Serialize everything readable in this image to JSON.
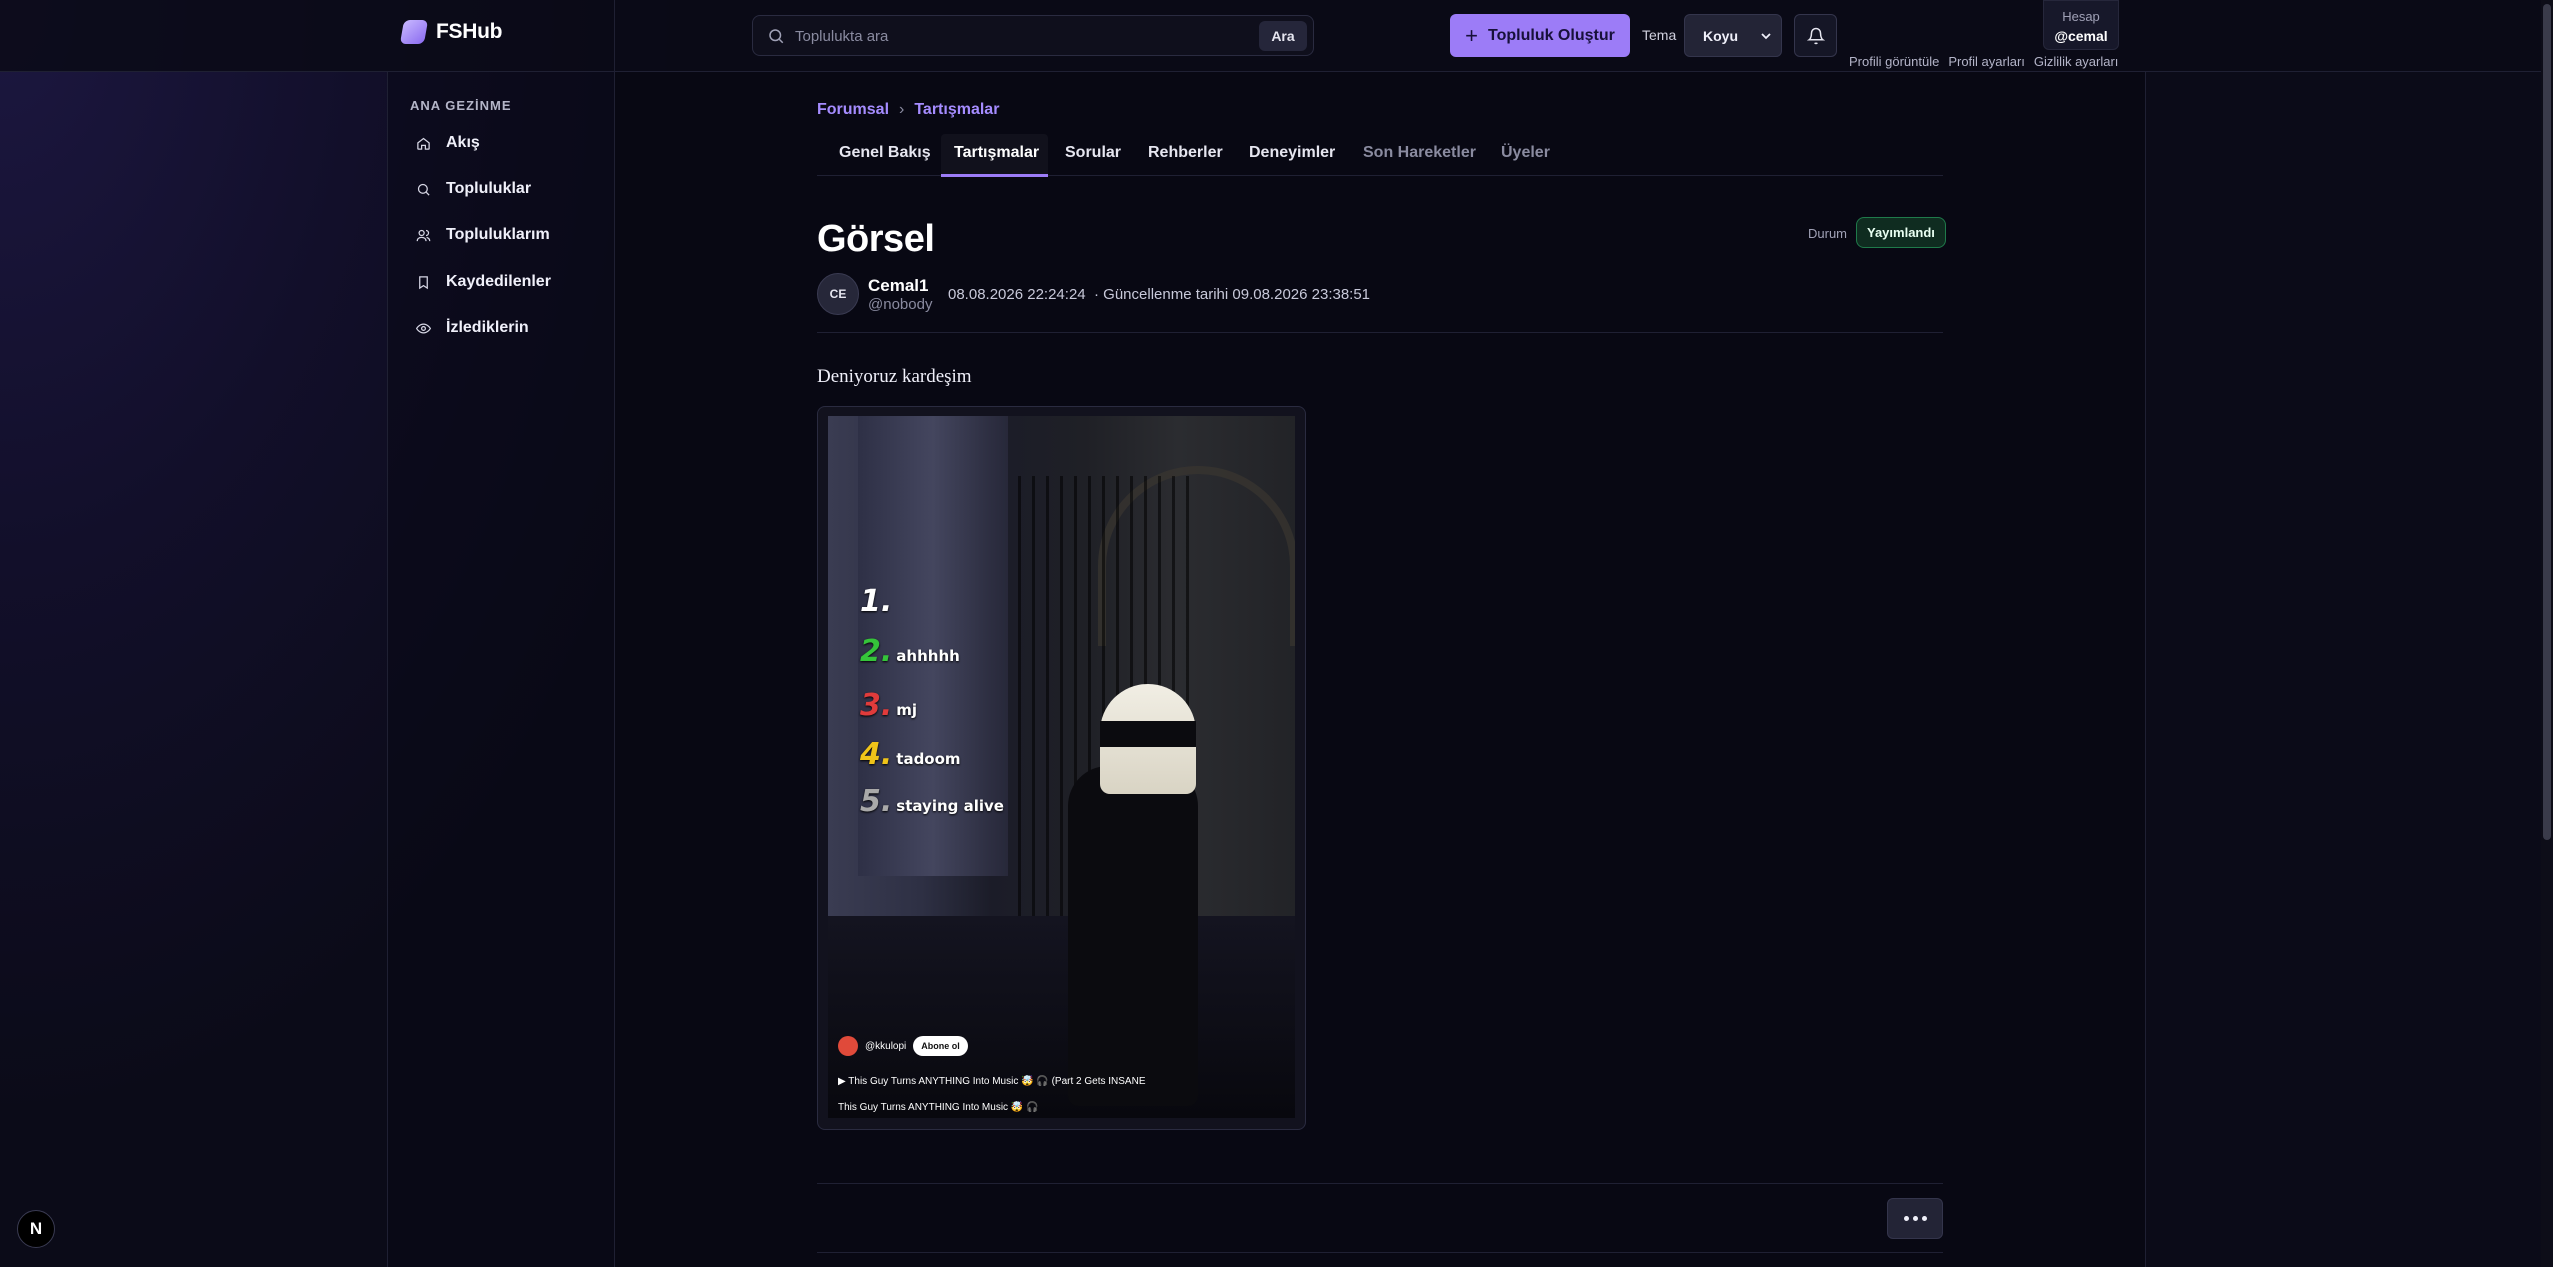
{
  "brand": {
    "name": "FSHub"
  },
  "search": {
    "placeholder": "Toplulukta ara",
    "button": "Ara"
  },
  "header": {
    "create_button": "Topluluk Oluştur",
    "theme_label": "Tema",
    "theme_value": "Koyu",
    "account_label": "Hesap",
    "account_user": "@cemal",
    "account_links": [
      "Profili görüntüle",
      "Profil ayarları",
      "Gizlilik ayarları"
    ]
  },
  "sidebar": {
    "heading": "ANA GEZİNME",
    "items": [
      {
        "label": "Akış",
        "icon": "home-icon"
      },
      {
        "label": "Topluluklar",
        "icon": "search-icon"
      },
      {
        "label": "Topluluklarım",
        "icon": "users-icon"
      },
      {
        "label": "Kaydedilenler",
        "icon": "bookmark-icon"
      },
      {
        "label": "İzlediklerin",
        "icon": "eye-icon"
      }
    ]
  },
  "breadcrumb": {
    "root": "Forumsal",
    "current": "Tartışmalar"
  },
  "tabs": [
    {
      "label": "Genel Bakış",
      "state": "normal"
    },
    {
      "label": "Tartışmalar",
      "state": "active"
    },
    {
      "label": "Sorular",
      "state": "normal"
    },
    {
      "label": "Rehberler",
      "state": "normal"
    },
    {
      "label": "Deneyimler",
      "state": "normal"
    },
    {
      "label": "Son Hareketler",
      "state": "muted"
    },
    {
      "label": "Üyeler",
      "state": "muted"
    }
  ],
  "post": {
    "title": "Görsel",
    "status_label": "Durum",
    "status_value": "Yayımlandı",
    "author_initials": "CE",
    "author_name": "Cemal1",
    "author_handle": "@nobody",
    "created": "08.08.2026 22:24:24",
    "updated": "· Güncellenme tarihi 09.08.2026 23:38:51",
    "body": "Deniyoruz kardeşim"
  },
  "media": {
    "ranks": [
      {
        "num": "1.",
        "text": ""
      },
      {
        "num": "2.",
        "text": "ahhhhh"
      },
      {
        "num": "3.",
        "text": "mj"
      },
      {
        "num": "4.",
        "text": "tadoom"
      },
      {
        "num": "5.",
        "text": "staying alive"
      }
    ],
    "channel": "@kkulopi",
    "subscribe": "Abone ol",
    "caption_1": "▶ This Guy Turns ANYTHING Into Music 🤯 🎧 (Part 2 Gets INSANE",
    "caption_2": "This Guy Turns ANYTHING Into Music 🤯 🎧"
  },
  "dev_badge": "N",
  "colors": {
    "accent": "#9c7cf7",
    "status_green": "#1f7a4a",
    "link": "#a58cff"
  }
}
